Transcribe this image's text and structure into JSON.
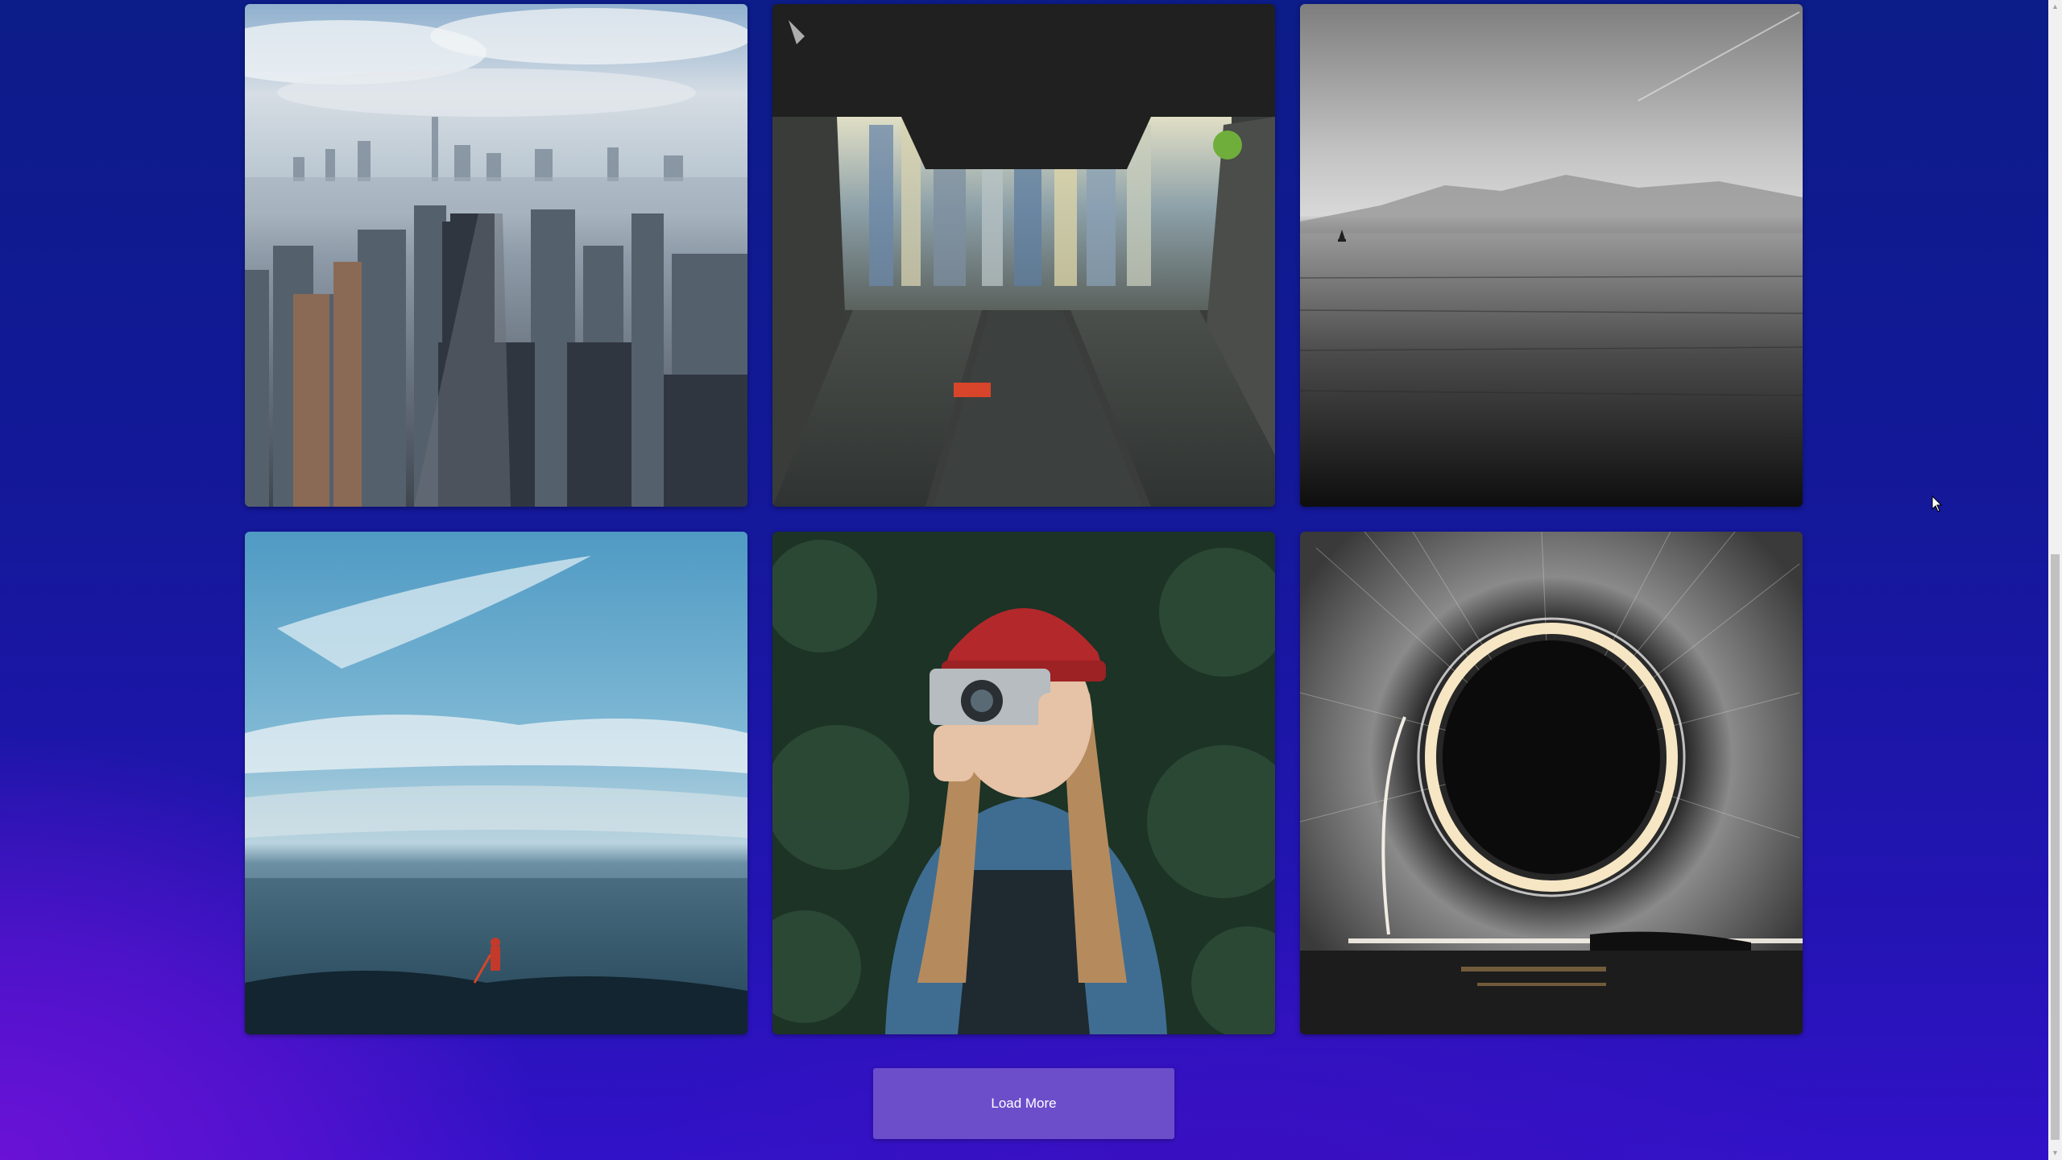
{
  "gallery": {
    "images": [
      {
        "name": "city-skyline-photo"
      },
      {
        "name": "blurred-street-under-structure-photo"
      },
      {
        "name": "monochrome-sea-sailboat-photo"
      },
      {
        "name": "paddleboarder-ocean-sky-photo"
      },
      {
        "name": "woman-with-camera-photo"
      },
      {
        "name": "steel-wool-light-circle-photo"
      }
    ]
  },
  "load_more": {
    "label": "Load More"
  },
  "colors": {
    "button": "#6c4ecb",
    "background_top": "#0c1c88",
    "background_bottom": "#3212c8"
  },
  "icons": {
    "cursor": "arrow-cursor-icon",
    "scroll_up": "scroll-up-arrow-icon",
    "scroll_down": "scroll-down-arrow-icon"
  }
}
